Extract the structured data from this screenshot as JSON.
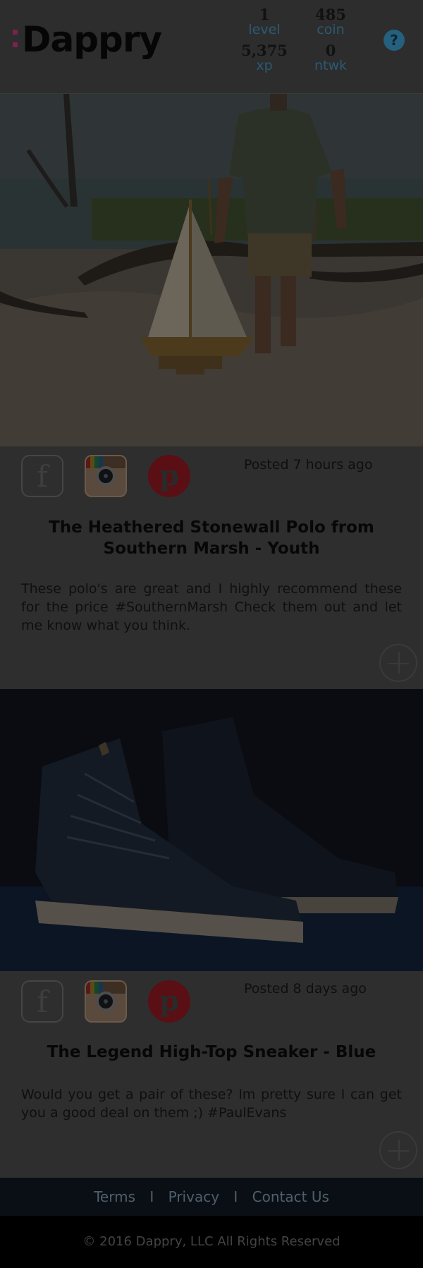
{
  "header": {
    "logo": "Dappry",
    "stats": [
      {
        "value": "1",
        "label": "level"
      },
      {
        "value": "485",
        "label": "coin"
      },
      {
        "value": "5,375",
        "label": "xp"
      },
      {
        "value": "0",
        "label": "ntwk"
      }
    ],
    "help_glyph": "?"
  },
  "posts": [
    {
      "posted": "Posted 7 hours ago",
      "title": "The Heathered Stonewall Polo from Southern Marsh - Youth",
      "body": "These polo's are great and I highly recommend these for the price #SouthernMarsh Check them out and let me know what you think.",
      "image_name": "boy-with-sailboat-photo"
    },
    {
      "posted": "Posted 8 days ago",
      "title": "The Legend High-Top Sneaker - Blue",
      "body": "Would you get a pair of these? Im pretty sure I can get you a good deal on them ;) #PaulEvans",
      "image_name": "high-top-sneaker-photo"
    }
  ],
  "share_icons": {
    "facebook": "f",
    "instagram": "instagram-icon",
    "pinterest": "p"
  },
  "footer": {
    "links": [
      "Terms",
      "Privacy",
      "Contact Us"
    ],
    "separator": "I",
    "copyright": "© 2016 Dappry, LLC All Rights Reserved"
  },
  "colors": {
    "logo_accent": "#e0357d",
    "stat_label": "#2f8fbf",
    "help_icon": "#3aa6dd",
    "pinterest": "#c8232c",
    "overlay": "rgba(0,0,0,0.55)"
  }
}
